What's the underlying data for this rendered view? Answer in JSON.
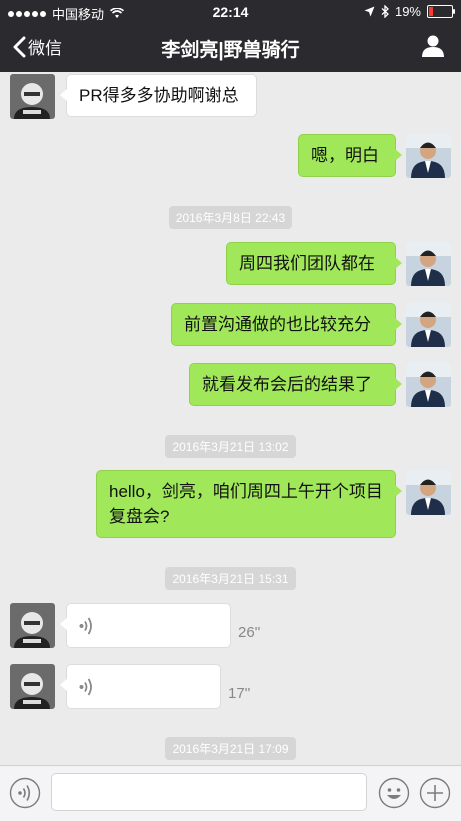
{
  "status": {
    "carrier": "中国移动",
    "time": "22:14",
    "battery": "19%"
  },
  "nav": {
    "back_label": "微信",
    "title": "李剑亮|野兽骑行"
  },
  "messages": [
    {
      "type": "text",
      "side": "left",
      "text": "PR得多多协助啊谢总"
    },
    {
      "type": "text",
      "side": "right",
      "text": "嗯，明白"
    },
    {
      "type": "timestamp",
      "text": "2016年3月8日 22:43"
    },
    {
      "type": "text",
      "side": "right",
      "text": "周四我们团队都在"
    },
    {
      "type": "text",
      "side": "right",
      "text": "前置沟通做的也比较充分"
    },
    {
      "type": "text",
      "side": "right",
      "text": "就看发布会后的结果了"
    },
    {
      "type": "timestamp",
      "text": "2016年3月21日 13:02"
    },
    {
      "type": "text",
      "side": "right",
      "text": "hello，剑亮，咱们周四上午开个项目复盘会?"
    },
    {
      "type": "timestamp",
      "text": "2016年3月21日 15:31"
    },
    {
      "type": "voice",
      "side": "left",
      "duration": "26''"
    },
    {
      "type": "voice",
      "side": "left",
      "duration": "17''"
    },
    {
      "type": "timestamp",
      "text": "2016年3月21日 17:09"
    }
  ],
  "input": {
    "placeholder": ""
  },
  "colors": {
    "nav_bg": "#2b2b2f",
    "chat_bg": "#ebebeb",
    "my_bubble": "#a0e75a",
    "their_bubble": "#ffffff"
  }
}
